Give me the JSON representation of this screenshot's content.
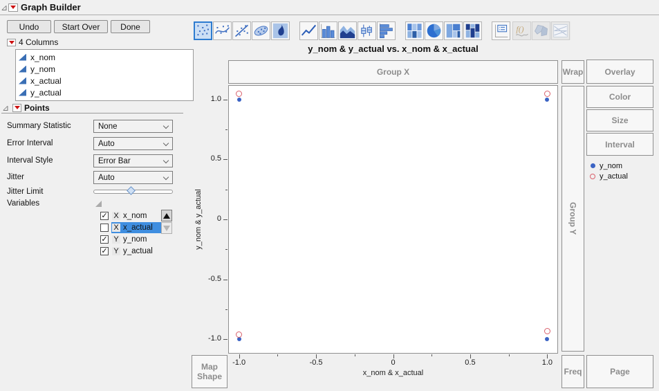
{
  "window": {
    "title": "Graph Builder"
  },
  "toolbar": {
    "undo": "Undo",
    "start_over": "Start Over",
    "done": "Done"
  },
  "columns_panel": {
    "header": "4 Columns",
    "columns": [
      "x_nom",
      "y_nom",
      "x_actual",
      "y_actual"
    ]
  },
  "points_panel": {
    "header": "Points",
    "fields": [
      {
        "label": "Summary Statistic",
        "value": "None",
        "type": "select"
      },
      {
        "label": "Error Interval",
        "value": "Auto",
        "type": "select"
      },
      {
        "label": "Interval Style",
        "value": "Error Bar",
        "type": "select"
      },
      {
        "label": "Jitter",
        "value": "Auto",
        "type": "select"
      },
      {
        "label": "Jitter Limit",
        "type": "slider",
        "thumb_percent": 48
      },
      {
        "label": "Variables",
        "type": "disclosure"
      }
    ],
    "variables": [
      {
        "checked": true,
        "role": "X",
        "name": "x_nom",
        "selected": false
      },
      {
        "checked": false,
        "role": "X",
        "name": "x_actual",
        "selected": true
      },
      {
        "checked": true,
        "role": "Y",
        "name": "y_nom",
        "selected": false
      },
      {
        "checked": true,
        "role": "Y",
        "name": "y_actual",
        "selected": false
      }
    ]
  },
  "element_toolbar": {
    "groups": [
      [
        "points",
        "smoother",
        "line-of-fit",
        "ellipse",
        "contour"
      ],
      [
        "line",
        "bar",
        "area",
        "box-plot",
        "histogram"
      ],
      [
        "heatmap",
        "pie",
        "treemap",
        "mosaic"
      ],
      [
        "caption-box"
      ],
      [
        "formula",
        "map-shapes",
        "parallel-plot"
      ]
    ],
    "selected": "points",
    "disabled": [
      "formula",
      "map-shapes",
      "parallel-plot"
    ]
  },
  "chart": {
    "zones": {
      "group_x": "Group X",
      "group_y": "Group Y",
      "wrap": "Wrap",
      "overlay": "Overlay",
      "color": "Color",
      "size": "Size",
      "interval": "Interval",
      "map_shape": "Map Shape",
      "freq": "Freq",
      "page": "Page"
    }
  },
  "chart_data": {
    "type": "scatter",
    "title": "y_nom & y_actual vs. x_nom & x_actual",
    "xlabel": "x_nom & x_actual",
    "ylabel": "y_nom & y_actual",
    "xlim": [
      -1.07,
      1.07
    ],
    "ylim": [
      -1.12,
      1.12
    ],
    "x_ticks": [
      -1.0,
      -0.5,
      0,
      0.5,
      1.0
    ],
    "y_ticks": [
      1.0,
      0.5,
      0,
      -0.5,
      -1.0
    ],
    "grid": false,
    "legend_position": "right",
    "series": [
      {
        "name": "y_nom",
        "marker": "filled-circle",
        "color": "#3b63c4",
        "points": [
          [
            -1,
            1.0
          ],
          [
            1,
            1.0
          ],
          [
            -1,
            -1.0
          ],
          [
            1,
            -1.0
          ]
        ]
      },
      {
        "name": "y_actual",
        "marker": "open-circle",
        "color": "#d9606c",
        "points": [
          [
            -1,
            1.05
          ],
          [
            1,
            1.05
          ],
          [
            -1,
            -0.96
          ],
          [
            1,
            -0.93
          ]
        ]
      }
    ]
  },
  "colors": {
    "accent": "#2e7cd0",
    "selection": "#3f8ee0",
    "point_blue": "#3b63c4",
    "point_red": "#d9606c",
    "zone_text": "#8c8c8c"
  }
}
